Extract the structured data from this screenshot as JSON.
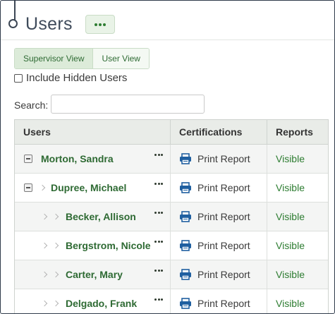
{
  "page": {
    "title": "Users",
    "more_actions_icon": "ellipsis-icon"
  },
  "view_toggle": [
    {
      "label": "Supervisor View",
      "active": true
    },
    {
      "label": "User View",
      "active": false
    }
  ],
  "include_hidden": {
    "label": "Include Hidden Users",
    "checked": false
  },
  "search": {
    "label": "Search:",
    "value": "",
    "placeholder": ""
  },
  "table": {
    "columns": [
      "Users",
      "Certifications",
      "Reports"
    ],
    "rows": [
      {
        "name": "Morton, Sandra",
        "level": 0,
        "control": "collapse",
        "cert": "Print Report",
        "report": "Visible"
      },
      {
        "name": "Dupree, Michael",
        "level": 1,
        "control": "collapse",
        "cert": "Print Report",
        "report": "Visible"
      },
      {
        "name": "Becker, Allison",
        "level": 2,
        "control": "none",
        "cert": "Print Report",
        "report": "Visible"
      },
      {
        "name": "Bergstrom, Nicole",
        "level": 2,
        "control": "none",
        "cert": "Print Report",
        "report": "Visible"
      },
      {
        "name": "Carter, Mary",
        "level": 2,
        "control": "none",
        "cert": "Print Report",
        "report": "Visible"
      },
      {
        "name": "Delgado, Frank",
        "level": 2,
        "control": "none",
        "cert": "Print Report",
        "report": "Visible"
      }
    ]
  },
  "colors": {
    "accent": "#2e7d32",
    "header_bg": "#e9ece8",
    "row_alt": "#f4f5f4",
    "print_icon": "#1f5fa0"
  }
}
